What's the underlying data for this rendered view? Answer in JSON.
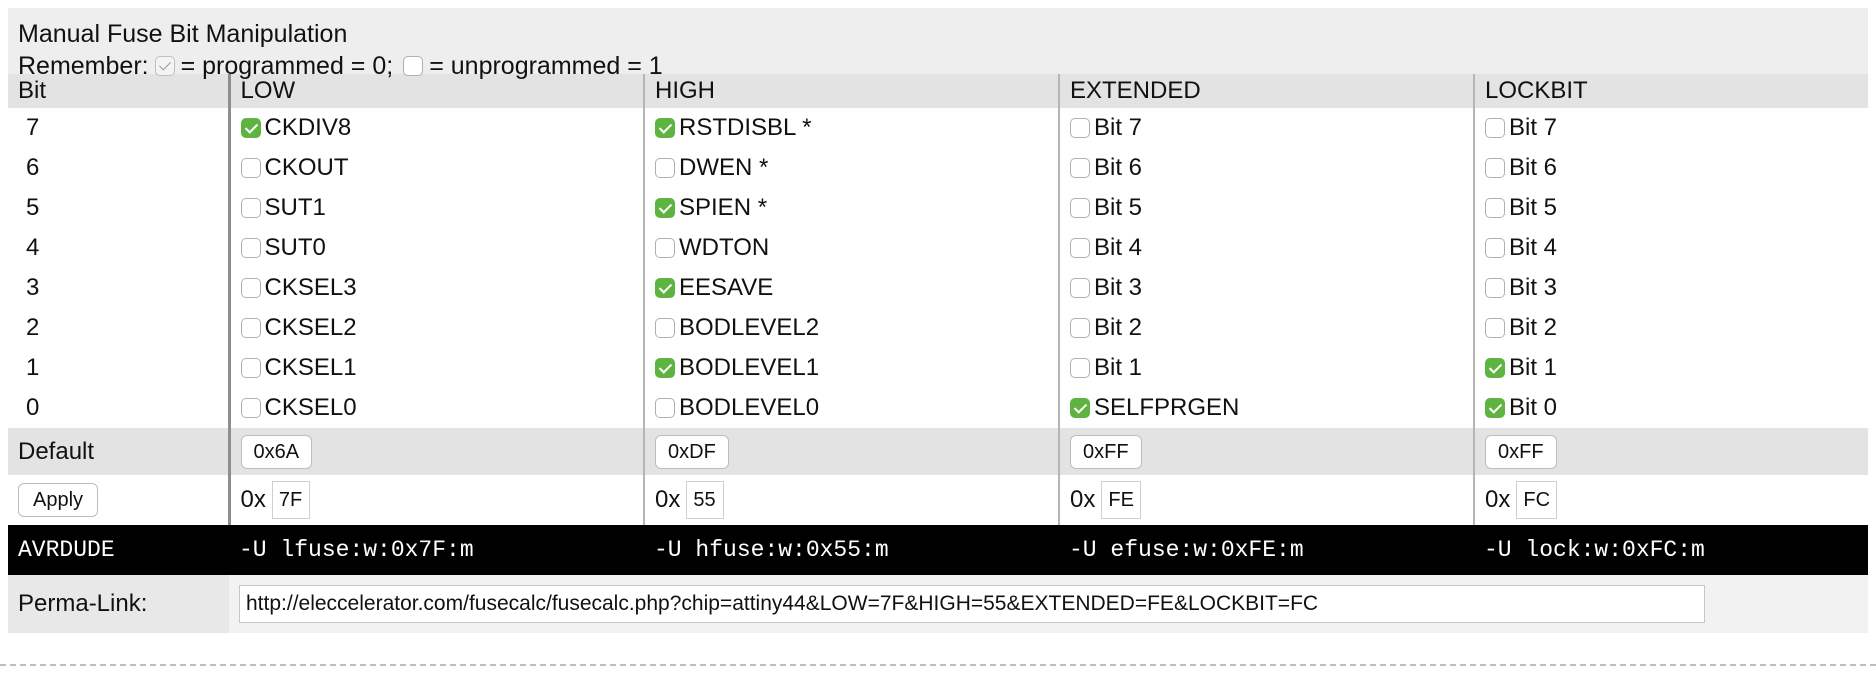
{
  "header": {
    "title": "Manual Fuse Bit Manipulation",
    "remember_prefix": "Remember:",
    "programmed_text": "= programmed = 0;",
    "unprogrammed_text": "= unprogrammed = 1"
  },
  "columns": [
    "Bit",
    "LOW",
    "HIGH",
    "EXTENDED",
    "LOCKBIT"
  ],
  "rows": [
    {
      "bit": "7",
      "low": "CKDIV8",
      "high": "RSTDISBL *",
      "ext": "Bit 7",
      "lock": "Bit 7"
    },
    {
      "bit": "6",
      "low": "CKOUT",
      "high": "DWEN *",
      "ext": "Bit 6",
      "lock": "Bit 6"
    },
    {
      "bit": "5",
      "low": "SUT1",
      "high": "SPIEN *",
      "ext": "Bit 5",
      "lock": "Bit 5"
    },
    {
      "bit": "4",
      "low": "SUT0",
      "high": "WDTON",
      "ext": "Bit 4",
      "lock": "Bit 4"
    },
    {
      "bit": "3",
      "low": "CKSEL3",
      "high": "EESAVE",
      "ext": "Bit 3",
      "lock": "Bit 3"
    },
    {
      "bit": "2",
      "low": "CKSEL2",
      "high": "BODLEVEL2",
      "ext": "Bit 2",
      "lock": "Bit 2"
    },
    {
      "bit": "1",
      "low": "CKSEL1",
      "high": "BODLEVEL1",
      "ext": "Bit 1",
      "lock": "Bit 1"
    },
    {
      "bit": "0",
      "low": "CKSEL0",
      "high": "BODLEVEL0",
      "ext": "SELFPRGEN",
      "lock": "Bit 0"
    }
  ],
  "checked": {
    "low": [
      true,
      false,
      false,
      false,
      false,
      false,
      false,
      false
    ],
    "high": [
      true,
      false,
      true,
      false,
      true,
      false,
      true,
      false
    ],
    "ext": [
      false,
      false,
      false,
      false,
      false,
      false,
      false,
      true
    ],
    "lock": [
      false,
      false,
      false,
      false,
      false,
      false,
      true,
      true
    ]
  },
  "defaults": {
    "label": "Default",
    "low": "0x6A",
    "high": "0xDF",
    "ext": "0xFF",
    "lock": "0xFF"
  },
  "apply": {
    "button_label": "Apply",
    "prefix": "0x",
    "low": "7F",
    "high": "55",
    "ext": "FE",
    "lock": "FC"
  },
  "avrdude": {
    "label": "AVRDUDE",
    "low": "-U lfuse:w:0x7F:m",
    "high": "-U hfuse:w:0x55:m",
    "ext": "-U efuse:w:0xFE:m",
    "lock": "-U lock:w:0xFC:m"
  },
  "permalink": {
    "label": "Perma-Link:",
    "url": "http://eleccelerator.com/fusecalc/fusecalc.php?chip=attiny44&LOW=7F&HIGH=55&EXTENDED=FE&LOCKBIT=FC"
  },
  "colors": {
    "checked": "#5fb340",
    "header_bg": "#e3e3e3",
    "avrdude_bg": "#000000"
  }
}
